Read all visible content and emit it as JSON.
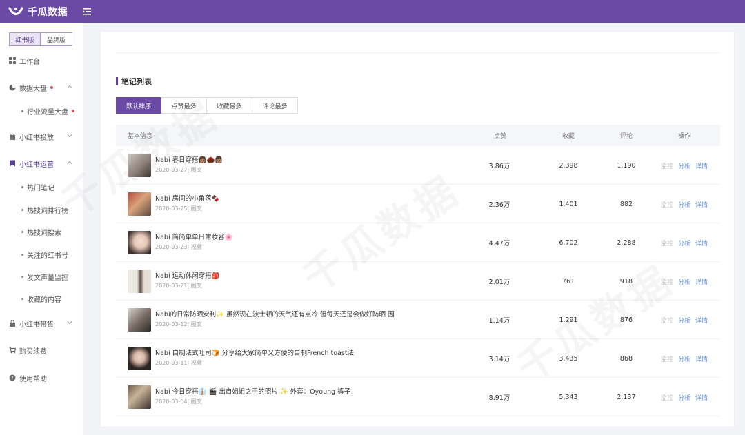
{
  "app": {
    "name": "千瓜数据"
  },
  "colors": {
    "brand": "#6a4aa5",
    "link": "#5b8fd9",
    "dot": "#e0504f"
  },
  "sidebar": {
    "version_tabs": [
      {
        "label": "红书版",
        "active": true
      },
      {
        "label": "品牌版",
        "active": false
      }
    ],
    "items": [
      {
        "label": "工作台",
        "icon": "grid-icon"
      },
      {
        "label": "数据大盘",
        "icon": "pie-chart-icon",
        "expanded": true,
        "has_dot": true
      },
      {
        "label": "行业流量大盘",
        "sub": true,
        "has_dot": true
      },
      {
        "label": "小红书投放",
        "icon": "bag-icon",
        "expanded": false
      },
      {
        "label": "小红书运营",
        "icon": "bookmark-icon",
        "expanded": true,
        "active": true
      },
      {
        "label": "热门笔记",
        "sub": true
      },
      {
        "label": "热搜词排行榜",
        "sub": true
      },
      {
        "label": "热搜词搜索",
        "sub": true
      },
      {
        "label": "关注的红书号",
        "sub": true
      },
      {
        "label": "发文声量监控",
        "sub": true
      },
      {
        "label": "收藏的内容",
        "sub": true
      },
      {
        "label": "小红书带货",
        "icon": "shop-icon",
        "expanded": false
      },
      {
        "label": "购买续费",
        "icon": "cart-icon"
      },
      {
        "label": "使用帮助",
        "icon": "help-icon"
      }
    ]
  },
  "main": {
    "section_title": "笔记列表",
    "sort_tabs": [
      "默认排序",
      "点赞最多",
      "收藏最多",
      "评论最多"
    ],
    "columns": [
      "基本信息",
      "点赞",
      "收藏",
      "评论",
      "操作"
    ],
    "actions": [
      "监控",
      "分析",
      "详情"
    ],
    "rows": [
      {
        "title": "Nabi 春日穿搭👩🏽🌰👩🏽",
        "meta": "2020-03-27| 图文",
        "likes": "3.86万",
        "favorites": "2,398",
        "comments": "1,190"
      },
      {
        "title": "Nabi 房间的小角落🍫",
        "meta": "2020-03-25| 图文",
        "likes": "2.36万",
        "favorites": "1,401",
        "comments": "882"
      },
      {
        "title": "Nabi 简简单单日常妆容🌸",
        "meta": "2020-03-23| 视频",
        "likes": "4.47万",
        "favorites": "6,702",
        "comments": "2,288"
      },
      {
        "title": "Nabi 运动休闲穿搭🎒",
        "meta": "2020-03-21| 图文",
        "likes": "2.01万",
        "favorites": "761",
        "comments": "918"
      },
      {
        "title": "Nabi的日常防晒安利✨ 虽然现在波士顿的天气还有点冷 但每天还是会做好防晒 因",
        "meta": "2020-03-12| 图文",
        "likes": "1.14万",
        "favorites": "1,291",
        "comments": "876"
      },
      {
        "title": "Nabi 自制法式吐司🍞 分享给大家简单又方便的自制French toast法",
        "meta": "2020-03-11| 视频",
        "likes": "3.14万",
        "favorites": "3,435",
        "comments": "868"
      },
      {
        "title": "Nabi 今日穿搭👔 🎬 出自姐姐之手的照片 ✨ 外套：Oyoung 裤子：",
        "meta": "2020-03-04| 图文",
        "likes": "8.91万",
        "favorites": "5,343",
        "comments": "2,137"
      }
    ]
  },
  "watermark": "千瓜数据"
}
